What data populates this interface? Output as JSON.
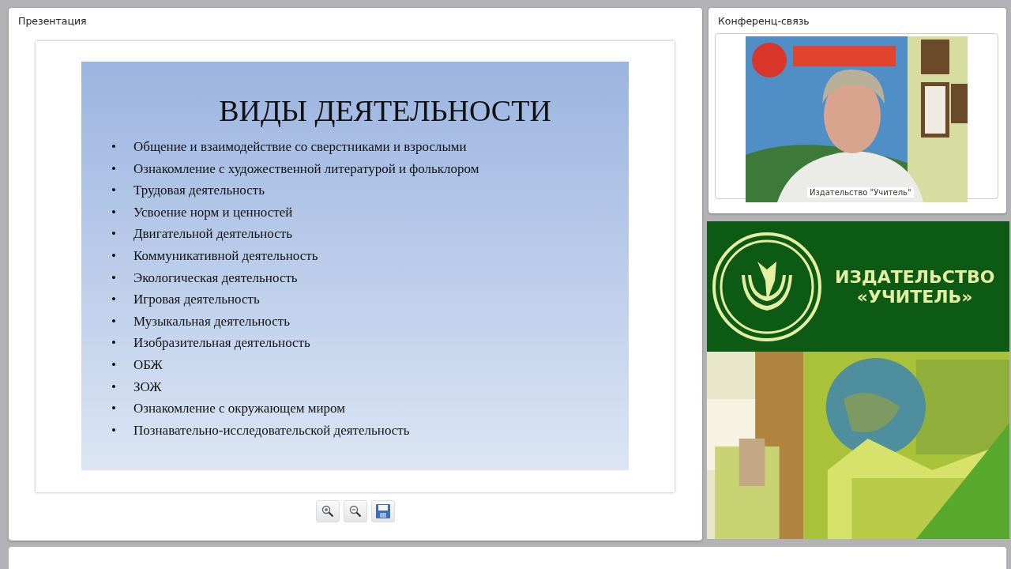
{
  "presentation": {
    "title": "Презентация",
    "slide": {
      "heading": "ВИДЫ ДЕЯТЕЛЬНОСТИ",
      "bullet": "•",
      "items": [
        "Общение и взаимодействие со сверстниками и взрослыми",
        "Ознакомление с художественной литературой и фольклором",
        "Трудовая деятельность",
        "Усвоение норм и ценностей",
        "Двигательной деятельность",
        "Коммуникативной деятельность",
        "Экологическая деятельность",
        "Игровая деятельность",
        "Музыкальная деятельность",
        "Изобразительная деятельность",
        "ОБЖ",
        "ЗОЖ",
        "Ознакомление с окружающем миром",
        "Познавательно-исследовательской деятельность"
      ]
    },
    "toolbar": [
      {
        "kind": "zoom-in"
      },
      {
        "kind": "zoom-out"
      },
      {
        "kind": "save"
      }
    ]
  },
  "conference": {
    "title": "Конференц-связь",
    "video": {
      "kind": "picture",
      "caption": "Издательство \"Учитель\""
    }
  },
  "banner": {
    "line_1": "ИЗДАТЕЛЬСТВО",
    "line_2": "«УЧИТЕЛЬ»"
  }
}
